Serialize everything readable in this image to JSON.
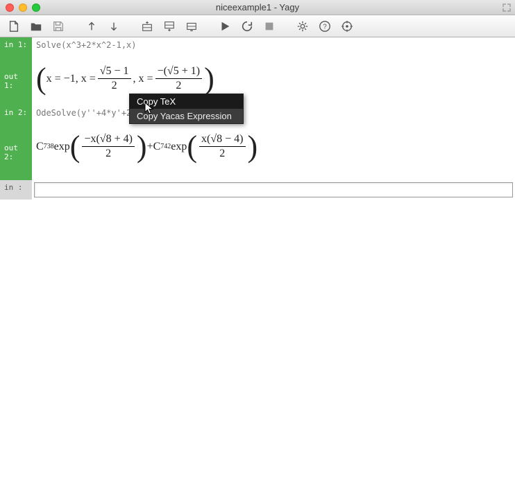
{
  "window": {
    "title": "niceexample1 - Yagy"
  },
  "cells": {
    "in1": {
      "label": "in  1:",
      "code": "Solve(x^3+2*x^2-1,x)"
    },
    "out1": {
      "label": "out 1:"
    },
    "in2": {
      "label": "in  2:",
      "code": "OdeSolve(y''+4*y'+2*y==0)"
    },
    "out2": {
      "label": "out 2:"
    },
    "in_empty": {
      "label": "in   :"
    }
  },
  "math": {
    "out1_x1": "x = −1, x = ",
    "out1_f1n": "√5 − 1",
    "out1_f1d": "2",
    "out1_mid": ", x = ",
    "out1_f2n": "−(√5 + 1)",
    "out1_f2d": "2",
    "out2_c1": "C",
    "out2_s1": "738",
    "out2_exp": " exp",
    "out2_f1n": "−x(√8 + 4)",
    "out2_f1d": "2",
    "out2_plus": " + ",
    "out2_c2": "C",
    "out2_s2": "742",
    "out2_f2n": "x(√8 − 4)",
    "out2_f2d": "2"
  },
  "context_menu": {
    "item1": "Copy TeX",
    "item2": "Copy Yacas Expression"
  }
}
